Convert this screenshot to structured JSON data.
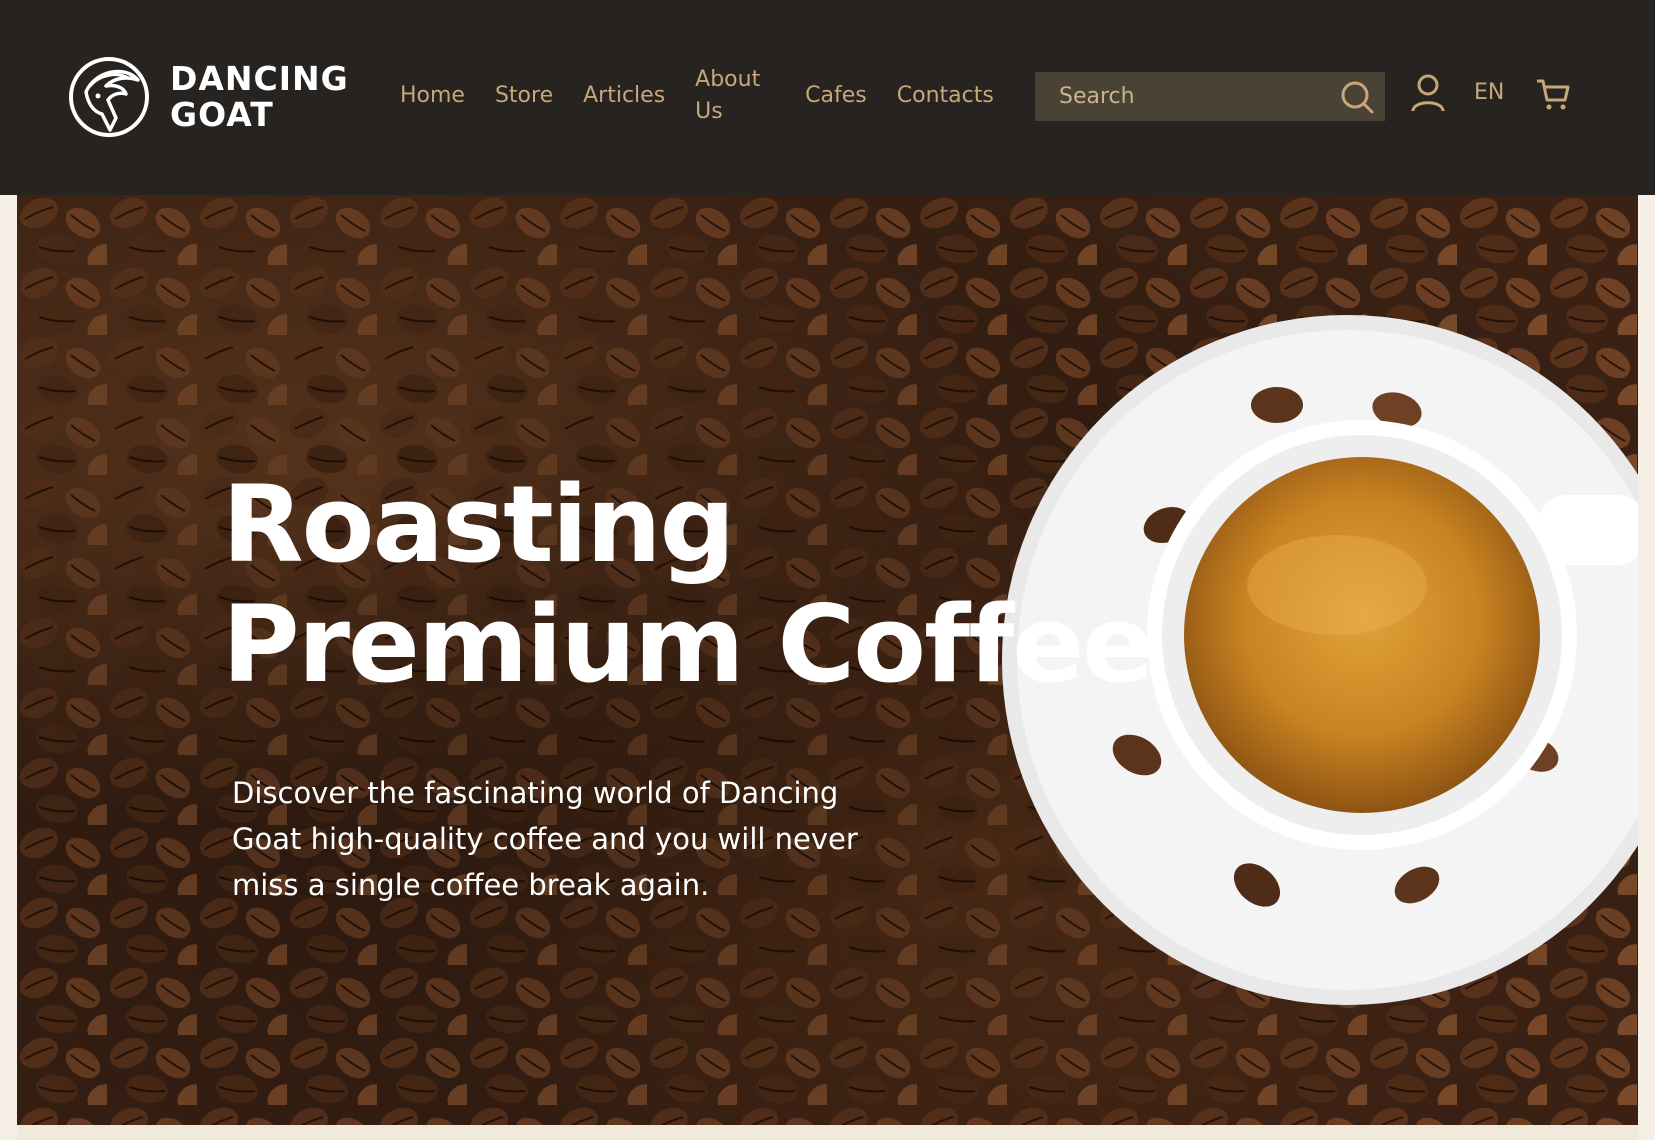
{
  "brand": {
    "line1": "DANCING",
    "line2": "GOAT",
    "logo_icon": "goat-head-icon"
  },
  "nav": {
    "items": [
      {
        "label": "Home"
      },
      {
        "label": "Store"
      },
      {
        "label": "Articles"
      },
      {
        "label": "About Us"
      },
      {
        "label": "Cafes"
      },
      {
        "label": "Contacts"
      }
    ]
  },
  "search": {
    "placeholder": "Search",
    "icon": "search-icon"
  },
  "header_actions": {
    "account_icon": "user-icon",
    "language": "EN",
    "cart_icon": "cart-icon"
  },
  "hero": {
    "title_line1": "Roasting",
    "title_line2": "Premium Coffee",
    "subtitle": "Discover the fascinating world of Dancing Goat high-quality coffee and you will never miss a single coffee break again.",
    "image": "coffee-beans-and-espresso-cup-image"
  },
  "colors": {
    "header_bg": "#262320",
    "nav_text": "#c7a779",
    "search_bg": "#4b4236",
    "hero_text": "#ffffff"
  }
}
